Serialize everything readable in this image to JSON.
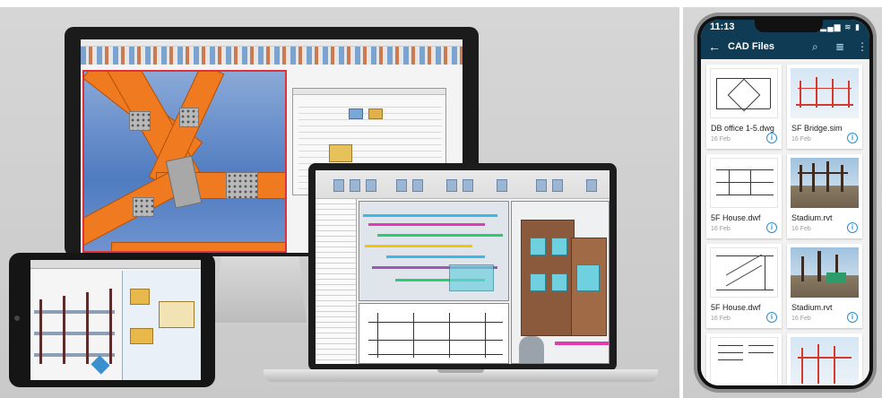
{
  "phone": {
    "status_time": "11:13",
    "status_icons": "▂▄▆ ≋ ▮",
    "appbar": {
      "title": "CAD Files",
      "back_icon": "arrow-left-icon",
      "search_icon": "search-icon",
      "list_icon": "list-view-icon",
      "menu_icon": "more-vert-icon"
    },
    "files": [
      {
        "name": "DB office 1-5.dwg",
        "date": "16 Feb",
        "thumb": "drawing"
      },
      {
        "name": "SF Bridge.sim",
        "date": "16 Feb",
        "thumb": "photo-red"
      },
      {
        "name": "5F House.dwf",
        "date": "16 Feb",
        "thumb": "drawing"
      },
      {
        "name": "Stadium.rvt",
        "date": "16 Feb",
        "thumb": "photo-site"
      },
      {
        "name": "5F House.dwf",
        "date": "16 Feb",
        "thumb": "drawing"
      },
      {
        "name": "Stadium.rvt",
        "date": "16 Feb",
        "thumb": "photo-site"
      },
      {
        "name": "",
        "date": "",
        "thumb": "drawing"
      },
      {
        "name": "",
        "date": "",
        "thumb": "photo-red"
      }
    ],
    "info_glyph": "i"
  },
  "colors": {
    "appbar": "#0f3b55",
    "steel": "#f07a1f",
    "accent_info": "#2a8fd0",
    "selection_border": "#e0303a"
  }
}
